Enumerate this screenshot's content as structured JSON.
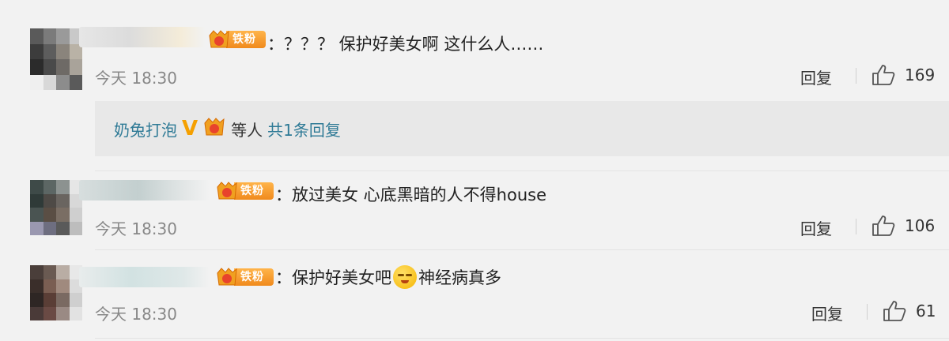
{
  "comments": [
    {
      "badge_label": "铁粉",
      "badge_level": "5",
      "text": "：？？？ 保护好美女啊 这什么人……",
      "time": "今天 18:30",
      "reply_label": "回复",
      "likes": "169"
    },
    {
      "badge_label": "铁粉",
      "badge_level": "3",
      "text": "：放过美女 心底黑暗的人不得house",
      "time": "今天 18:30",
      "reply_label": "回复",
      "likes": "106"
    },
    {
      "badge_label": "铁粉",
      "badge_level": "2",
      "text_before_emoji": "：保护好美女吧",
      "text_after_emoji": "神经病真多",
      "emoji": "sleepy-face-icon",
      "time": "今天 18:30",
      "reply_label": "回复",
      "likes": "61"
    }
  ],
  "sub_reply": {
    "user": "奶兔打泡",
    "suffix": "等人",
    "link": "共1条回复",
    "badge_level": "5"
  },
  "colors": {
    "background": "#f2f2f2",
    "link": "#2e7a96",
    "badge": "#f08a1c",
    "vip": "#f5a000"
  }
}
